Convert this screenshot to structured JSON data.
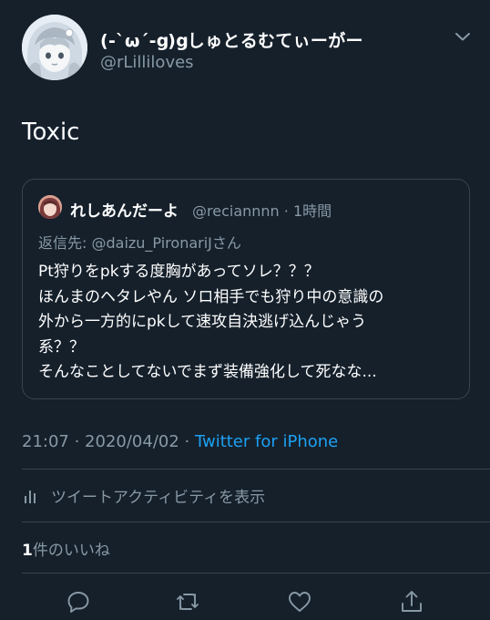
{
  "author": {
    "display_name": "(-`ω´-ց)ցしゅとるむてぃーがー",
    "handle": "@rLilliloves",
    "avatar_icon": "avatar-anime-illustration"
  },
  "tweet": {
    "text": "Toxic"
  },
  "quoted_tweet": {
    "display_name": "れしあんだーよ",
    "handle_time": "@reciannnn · 1時間",
    "reply_prefix": "返信先: ",
    "reply_target": "@daizu_PironariJさん",
    "lines": [
      "Pt狩りをpkする度胸があってソレ？？？",
      "ほんまのヘタレやん ソロ相手でも狩り中の意識の",
      "外から一方的にpkして速攻自決逃げ込んじゃう",
      "系？？",
      "そんなことしてないでまず装備強化して死なな..."
    ]
  },
  "meta": {
    "time_date": "21:07 · 2020/04/02 · ",
    "source": "Twitter for iPhone"
  },
  "activity": {
    "label": "ツイートアクティビティを表示",
    "icon": "bar-chart-icon"
  },
  "likes": {
    "count": "1",
    "label": "件のいいね"
  },
  "actions": [
    "reply",
    "retweet",
    "like",
    "share"
  ],
  "colors": {
    "background": "#15202b",
    "text_primary": "#ffffff",
    "text_secondary": "#8899a6",
    "accent": "#1da1f2",
    "border": "#38444d"
  }
}
